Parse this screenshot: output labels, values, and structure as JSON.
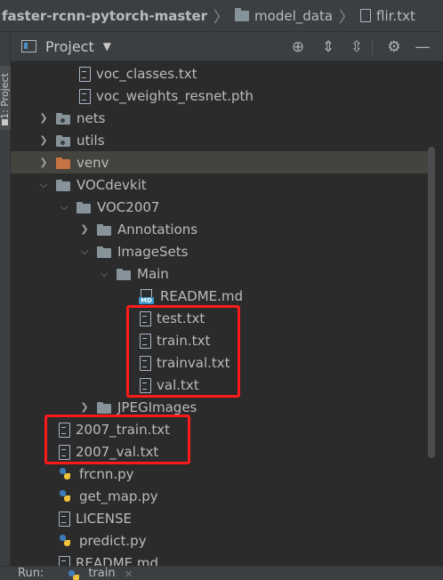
{
  "breadcrumb": {
    "project": "faster-rcnn-pytorch-master",
    "folder": "model_data",
    "file": "flir.txt"
  },
  "tool_window": {
    "tab_label": "1: Project",
    "title": "Project",
    "dropdown_icon": "caret-down",
    "buttons": [
      "locate-icon",
      "expand-all-icon",
      "collapse-all-icon",
      "gear-icon",
      "hide-icon"
    ]
  },
  "tree": {
    "rows": [
      {
        "label": "voc_classes.txt",
        "icon": "text-file-icon"
      },
      {
        "label": "voc_weights_resnet.pth",
        "icon": "text-file-icon"
      },
      {
        "label": "nets",
        "icon": "package-folder-icon",
        "expanded": false
      },
      {
        "label": "utils",
        "icon": "package-folder-icon",
        "expanded": false
      },
      {
        "label": "venv",
        "icon": "excluded-folder-icon",
        "expanded": false,
        "selected": true
      },
      {
        "label": "VOCdevkit",
        "icon": "folder-icon",
        "expanded": true
      },
      {
        "label": "VOC2007",
        "icon": "folder-icon",
        "expanded": true
      },
      {
        "label": "Annotations",
        "icon": "folder-icon",
        "expanded": false
      },
      {
        "label": "ImageSets",
        "icon": "folder-icon",
        "expanded": true
      },
      {
        "label": "Main",
        "icon": "folder-icon",
        "expanded": true
      },
      {
        "label": "README.md",
        "icon": "markdown-file-icon"
      },
      {
        "label": "test.txt",
        "icon": "text-file-icon"
      },
      {
        "label": "train.txt",
        "icon": "text-file-icon"
      },
      {
        "label": "trainval.txt",
        "icon": "text-file-icon"
      },
      {
        "label": "val.txt",
        "icon": "text-file-icon"
      },
      {
        "label": "JPEGImages",
        "icon": "folder-icon",
        "expanded": false
      },
      {
        "label": "2007_train.txt",
        "icon": "text-file-icon"
      },
      {
        "label": "2007_val.txt",
        "icon": "text-file-icon"
      },
      {
        "label": "frcnn.py",
        "icon": "python-file-icon"
      },
      {
        "label": "get_map.py",
        "icon": "python-file-icon"
      },
      {
        "label": "LICENSE",
        "icon": "text-file-icon"
      },
      {
        "label": "predict.py",
        "icon": "python-file-icon"
      },
      {
        "label": "README.md",
        "icon": "markdown-file-icon"
      }
    ]
  },
  "run_bar": {
    "label": "Run:",
    "config": "train",
    "close_glyph": "×"
  },
  "colors": {
    "highlight": "#ff1a1a",
    "background": "#2b2b2b",
    "excluded_folder": "#c77444"
  }
}
